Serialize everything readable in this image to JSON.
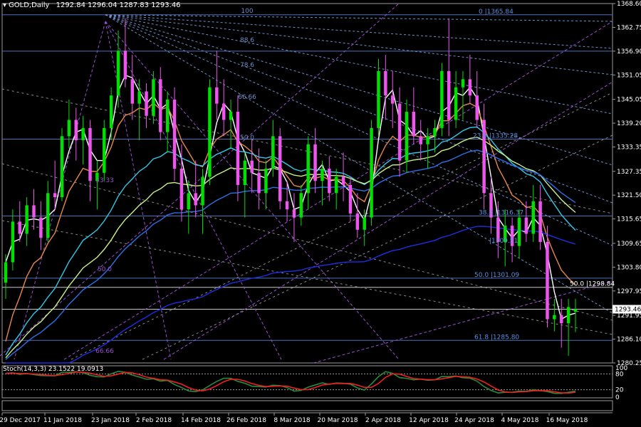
{
  "header": {
    "symbol": "GOLD,Daily",
    "ohlc": "1292.84 1296.04 1287.83 1293.46"
  },
  "stoch_header": {
    "label": "Stoch(14,3,3) 23.1522 19.0913"
  },
  "colors": {
    "background": "#000000",
    "bull": "#00e000",
    "bear": "#ee55ee",
    "grid_line": "#4a73b8",
    "fib_ray": "#6f8fc8",
    "purple_ray": "#9a4fd0",
    "gray_ray": "#8a8a8a",
    "white_ma": "#ffffff",
    "orange_ma": "#e8884a",
    "cyan_ma": "#33c8e8",
    "lightgreen_ma": "#c8f08a",
    "blue_ma": "#2f6fe8",
    "darkblue_ma": "#1e2fe0",
    "stoch_main": "#2a8a3a",
    "stoch_signal": "#ee2020"
  },
  "chart_data": {
    "type": "candlestick",
    "symbol": "GOLD",
    "timeframe": "Daily",
    "ylim": [
      1280.25,
      1368.6
    ],
    "y_ticks": [
      "1368.60",
      "1362.75",
      "1356.90",
      "1351.05",
      "1345.05",
      "1339.20",
      "1333.35",
      "1327.35",
      "1321.50",
      "1315.65",
      "1309.65",
      "1303.80",
      "1297.95",
      "1291.95",
      "1286.10",
      "1280.25"
    ],
    "current_price": "1293.46",
    "x_labels": [
      "29 Dec 2017",
      "11 Jan 2018",
      "23 Jan 2018",
      "2 Feb 2018",
      "14 Feb 2018",
      "26 Feb 2018",
      "8 Mar 2018",
      "20 Mar 2018",
      "2 Apr 2018",
      "12 Apr 2018",
      "24 Apr 2018",
      "4 May 2018",
      "16 May 2018"
    ],
    "fib_fan_labels": [
      "100",
      "88.6",
      "78.6",
      "66.66",
      "50.0",
      "33.33"
    ],
    "fib_fan_lower_labels": [
      "50.0",
      "66.66"
    ],
    "level_labels": [
      {
        "text": "0  |1365.84",
        "price": 1365.84
      },
      {
        "text": "23.6  |1335.28",
        "price": 1335.28
      },
      {
        "text": "38.2  |1316.37",
        "price": 1316.37
      },
      {
        "text": "|1309.51",
        "price": 1309.51
      },
      {
        "text": "50.0  |1301.09",
        "price": 1301.09
      },
      {
        "text": "50.0  |1298.84",
        "price": 1298.84
      },
      {
        "text": "61.8  |1285.80",
        "price": 1285.8
      }
    ],
    "horizontal_levels": [
      1365.84,
      1356.9,
      1335.28,
      1316.37,
      1301.09,
      1298.84,
      1293.46,
      1285.8
    ],
    "candles": [
      [
        1300,
        1307,
        1296,
        1305
      ],
      [
        1305,
        1318,
        1303,
        1315
      ],
      [
        1315,
        1320,
        1310,
        1312
      ],
      [
        1312,
        1321,
        1309,
        1319
      ],
      [
        1319,
        1323,
        1313,
        1316
      ],
      [
        1316,
        1320,
        1308,
        1311
      ],
      [
        1311,
        1325,
        1310,
        1322
      ],
      [
        1322,
        1330,
        1318,
        1321
      ],
      [
        1321,
        1338,
        1320,
        1336
      ],
      [
        1336,
        1345,
        1333,
        1340
      ],
      [
        1340,
        1343,
        1330,
        1335
      ],
      [
        1335,
        1341,
        1329,
        1338
      ],
      [
        1338,
        1340,
        1320,
        1325
      ],
      [
        1325,
        1330,
        1318,
        1327
      ],
      [
        1327,
        1340,
        1325,
        1338
      ],
      [
        1338,
        1348,
        1335,
        1346
      ],
      [
        1346,
        1362,
        1343,
        1357
      ],
      [
        1357,
        1365,
        1348,
        1350
      ],
      [
        1350,
        1356,
        1340,
        1344
      ],
      [
        1344,
        1350,
        1335,
        1347
      ],
      [
        1347,
        1349,
        1338,
        1341
      ],
      [
        1341,
        1352,
        1339,
        1350
      ],
      [
        1350,
        1353,
        1335,
        1337
      ],
      [
        1337,
        1347,
        1332,
        1345
      ],
      [
        1345,
        1348,
        1325,
        1328
      ],
      [
        1328,
        1334,
        1315,
        1318
      ],
      [
        1318,
        1325,
        1312,
        1322
      ],
      [
        1322,
        1330,
        1316,
        1319
      ],
      [
        1319,
        1328,
        1312,
        1326
      ],
      [
        1326,
        1350,
        1324,
        1348
      ],
      [
        1348,
        1357,
        1340,
        1344
      ],
      [
        1344,
        1350,
        1336,
        1340
      ],
      [
        1340,
        1345,
        1333,
        1342
      ],
      [
        1342,
        1346,
        1320,
        1324
      ],
      [
        1324,
        1332,
        1316,
        1330
      ],
      [
        1330,
        1335,
        1322,
        1327
      ],
      [
        1327,
        1333,
        1318,
        1322
      ],
      [
        1322,
        1330,
        1318,
        1328
      ],
      [
        1328,
        1340,
        1326,
        1336
      ],
      [
        1336,
        1338,
        1318,
        1320
      ],
      [
        1320,
        1325,
        1315,
        1318
      ],
      [
        1318,
        1322,
        1310,
        1316
      ],
      [
        1316,
        1324,
        1314,
        1322
      ],
      [
        1322,
        1336,
        1318,
        1334
      ],
      [
        1334,
        1338,
        1322,
        1325
      ],
      [
        1325,
        1330,
        1319,
        1328
      ],
      [
        1328,
        1331,
        1320,
        1322
      ],
      [
        1322,
        1328,
        1318,
        1326
      ],
      [
        1326,
        1332,
        1320,
        1324
      ],
      [
        1324,
        1326,
        1315,
        1317
      ],
      [
        1317,
        1322,
        1311,
        1313
      ],
      [
        1313,
        1318,
        1309,
        1316
      ],
      [
        1316,
        1340,
        1314,
        1338
      ],
      [
        1338,
        1355,
        1336,
        1352
      ],
      [
        1352,
        1356,
        1340,
        1346
      ],
      [
        1346,
        1352,
        1338,
        1344
      ],
      [
        1344,
        1348,
        1326,
        1330
      ],
      [
        1330,
        1345,
        1327,
        1342
      ],
      [
        1342,
        1348,
        1334,
        1336
      ],
      [
        1336,
        1340,
        1330,
        1334
      ],
      [
        1334,
        1338,
        1328,
        1336
      ],
      [
        1336,
        1340,
        1332,
        1338
      ],
      [
        1338,
        1354,
        1336,
        1352
      ],
      [
        1352,
        1365,
        1336,
        1340
      ],
      [
        1340,
        1352,
        1338,
        1348
      ],
      [
        1348,
        1352,
        1340,
        1350
      ],
      [
        1350,
        1356,
        1344,
        1346
      ],
      [
        1346,
        1352,
        1338,
        1340
      ],
      [
        1340,
        1344,
        1318,
        1322
      ],
      [
        1322,
        1326,
        1312,
        1316
      ],
      [
        1316,
        1320,
        1306,
        1310
      ],
      [
        1310,
        1318,
        1304,
        1314
      ],
      [
        1314,
        1316,
        1305,
        1309
      ],
      [
        1309,
        1318,
        1306,
        1316
      ],
      [
        1316,
        1320,
        1310,
        1312
      ],
      [
        1312,
        1324,
        1310,
        1320
      ],
      [
        1320,
        1324,
        1308,
        1310
      ],
      [
        1310,
        1314,
        1289,
        1291
      ],
      [
        1291,
        1296,
        1288,
        1292
      ],
      [
        1292,
        1296,
        1284,
        1290
      ],
      [
        1290,
        1296,
        1282,
        1294
      ],
      [
        1292.84,
        1296.04,
        1287.83,
        1293.46
      ]
    ],
    "series": [
      {
        "name": "",
        "color": "white_ma"
      },
      {
        "name": "",
        "color": "orange_ma"
      },
      {
        "name": "",
        "color": "cyan_ma"
      },
      {
        "name": "",
        "color": "lightgreen_ma"
      },
      {
        "name": "",
        "color": "blue_ma"
      },
      {
        "name": "",
        "color": "darkblue_ma"
      }
    ],
    "stochastic": {
      "params": "14,3,3",
      "main": 23.1522,
      "signal": 19.0913,
      "levels": [
        80,
        20
      ],
      "scale_labels": [
        "100",
        "80",
        "20",
        "0"
      ]
    }
  }
}
